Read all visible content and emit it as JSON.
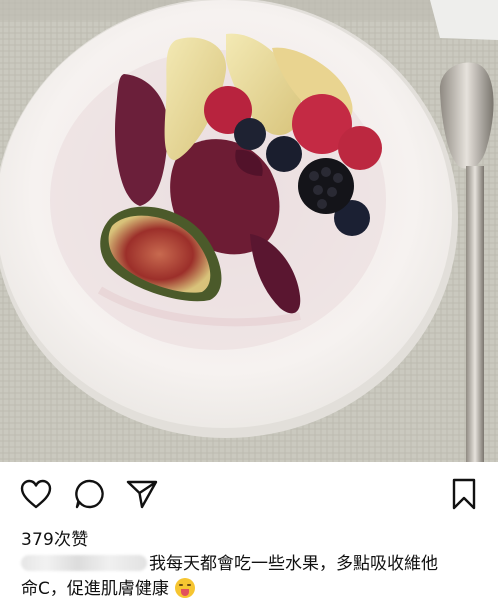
{
  "post": {
    "image_alt": "fruit plate",
    "likes_text": "379次赞",
    "caption_text_line1": "我每天都會吃一些水果，多點吸收維他",
    "caption_text_line2": "命C，促進肌膚健康",
    "emoji": "crazy-face-emoji"
  },
  "actions": {
    "like_icon": "heart-icon",
    "comment_icon": "comment-icon",
    "share_icon": "send-icon",
    "save_icon": "bookmark-icon"
  },
  "colors": {
    "plate": "#f4f1ee",
    "tablecloth": "#c9c8bd",
    "text": "#111111"
  }
}
